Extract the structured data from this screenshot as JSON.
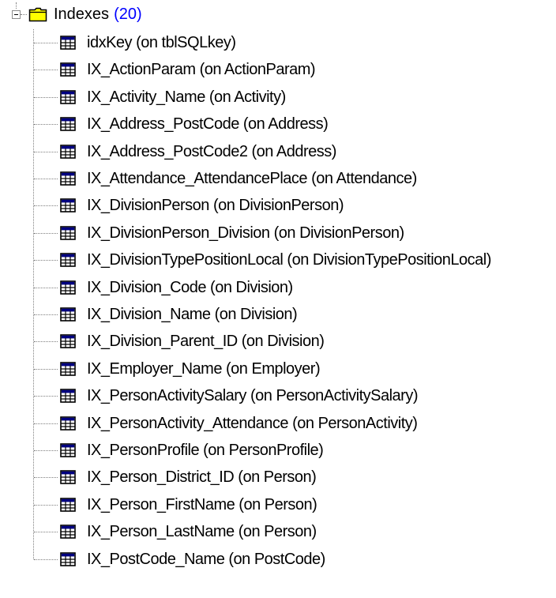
{
  "tree": {
    "root": {
      "label": "Indexes",
      "count": "(20)",
      "icon": "folder-icon",
      "expander_icon": "collapse-icon"
    },
    "child_icon": "table-index-icon",
    "items": [
      {
        "label": "idxKey (on tblSQLkey)"
      },
      {
        "label": "IX_ActionParam (on ActionParam)"
      },
      {
        "label": "IX_Activity_Name (on Activity)"
      },
      {
        "label": "IX_Address_PostCode (on Address)"
      },
      {
        "label": "IX_Address_PostCode2 (on Address)"
      },
      {
        "label": "IX_Attendance_AttendancePlace (on Attendance)"
      },
      {
        "label": "IX_DivisionPerson (on DivisionPerson)"
      },
      {
        "label": "IX_DivisionPerson_Division (on DivisionPerson)"
      },
      {
        "label": "IX_DivisionTypePositionLocal (on DivisionTypePositionLocal)"
      },
      {
        "label": "IX_Division_Code (on Division)"
      },
      {
        "label": "IX_Division_Name (on Division)"
      },
      {
        "label": "IX_Division_Parent_ID (on Division)"
      },
      {
        "label": "IX_Employer_Name (on Employer)"
      },
      {
        "label": "IX_PersonActivitySalary (on PersonActivitySalary)"
      },
      {
        "label": "IX_PersonActivity_Attendance (on PersonActivity)"
      },
      {
        "label": "IX_PersonProfile (on PersonProfile)"
      },
      {
        "label": "IX_Person_District_ID (on Person)"
      },
      {
        "label": "IX_Person_FirstName (on Person)"
      },
      {
        "label": "IX_Person_LastName (on Person)"
      },
      {
        "label": "IX_PostCode_Name (on PostCode)"
      }
    ],
    "colors": {
      "folder_fill": "#ffff00",
      "folder_outline": "#000000",
      "count_text": "#0000ff",
      "connector": "#7f7f7f"
    }
  }
}
